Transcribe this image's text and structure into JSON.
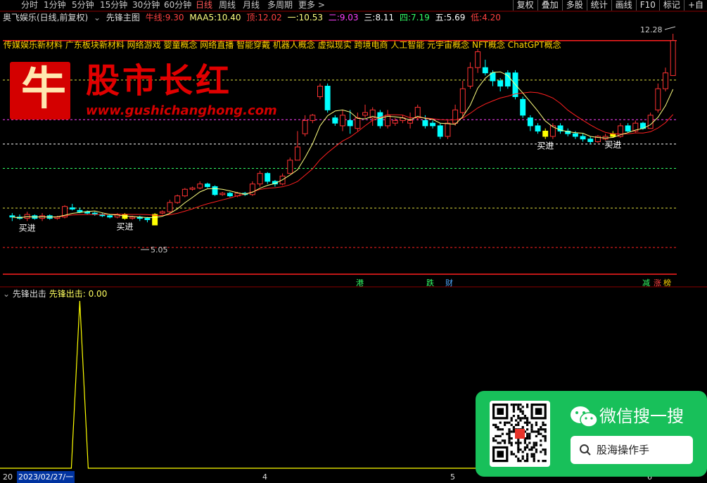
{
  "toolbar": {
    "timeframes": [
      "分时",
      "1分钟",
      "5分钟",
      "15分钟",
      "30分钟",
      "60分钟",
      "日线",
      "周线",
      "月线",
      "多周期",
      "更多 >"
    ],
    "active_timeframe": "日线",
    "right_buttons": [
      "复权",
      "叠加",
      "多股",
      "统计",
      "画线",
      "F10",
      "标记",
      "+自"
    ]
  },
  "info": {
    "stock": "奥飞娱乐(日线,前复权)",
    "indicator": "先锋主图",
    "niu_label": "牛线:",
    "niu": "9.30",
    "maa5_label": "MAA5:",
    "maa5": "10.40",
    "ding_label": "顶:",
    "ding": "12.02",
    "yi_label": "一:",
    "yi": "10.53",
    "er_label": "二:",
    "er": "9.03",
    "san_label": "三:",
    "san": "8.11",
    "si_label": "四:",
    "si": "7.19",
    "wu_label": "五:",
    "wu": "5.69",
    "di_label": "低:",
    "di": "4.20"
  },
  "concepts": "传媒娱乐新材料 广东板块新材料 网络游戏 婴童概念 网络直播 智能穿戴 机器人概念 虚拟现实 跨境电商 人工智能 元宇宙概念 NFT概念 ChatGPT概念",
  "logo": {
    "char": "牛",
    "title": "股市长红",
    "url": "www.gushichanghong.com"
  },
  "chart_annotations": {
    "high": "12.28",
    "low": "5.05",
    "buy": "买进"
  },
  "event_tags": [
    {
      "text": "港",
      "color": "#33ff66"
    },
    {
      "text": "跌",
      "color": "#33ff66"
    },
    {
      "text": "财",
      "color": "#4fa8ff"
    },
    {
      "text": "减",
      "color": "#33ff66"
    },
    {
      "text": "涨",
      "color": "#ff4040"
    },
    {
      "text": "榜",
      "color": "#ffd400"
    }
  ],
  "sub_indicator": {
    "name": "先锋出击",
    "label": "先锋出击:",
    "value": "0.00"
  },
  "date_axis": {
    "start": "20",
    "current": "2023/02/27/一",
    "m4": "4",
    "m5": "5",
    "m6": "6"
  },
  "wechat": {
    "title": "微信搜一搜",
    "search": "股海操作手"
  },
  "colors": {
    "up": "#ff3232",
    "down": "#00ffff",
    "ma_fast": "#ffff80",
    "ma_slow": "#ff2020",
    "signal": "#ffff00"
  },
  "chart_data": {
    "type": "candlestick",
    "price_range": [
      4.2,
      12.28
    ],
    "reference_levels": [
      12.02,
      10.53,
      9.03,
      8.11,
      7.19,
      5.69,
      4.2
    ],
    "candles": [
      [
        5.4,
        5.35,
        5.5,
        5.2
      ],
      [
        5.35,
        5.3,
        5.45,
        5.25
      ],
      [
        5.3,
        5.45,
        5.55,
        5.2
      ],
      [
        5.4,
        5.3,
        5.45,
        5.25
      ],
      [
        5.3,
        5.4,
        5.5,
        5.2
      ],
      [
        5.4,
        5.3,
        5.45,
        5.25
      ],
      [
        5.3,
        5.35,
        5.4,
        5.25
      ],
      [
        5.35,
        5.75,
        5.8,
        5.3
      ],
      [
        5.7,
        5.65,
        5.85,
        5.6
      ],
      [
        5.6,
        5.55,
        5.7,
        5.5
      ],
      [
        5.55,
        5.5,
        5.6,
        5.45
      ],
      [
        5.5,
        5.45,
        5.55,
        5.4
      ],
      [
        5.45,
        5.4,
        5.5,
        5.35
      ],
      [
        5.4,
        5.35,
        5.45,
        5.3
      ],
      [
        5.35,
        5.45,
        5.5,
        5.3
      ],
      [
        5.45,
        5.3,
        5.5,
        5.25
      ],
      [
        5.3,
        5.35,
        5.4,
        5.25
      ],
      [
        5.35,
        5.3,
        5.4,
        5.2
      ],
      [
        5.3,
        5.25,
        5.35,
        5.15
      ],
      [
        5.05,
        5.45,
        5.5,
        5.05
      ],
      [
        5.5,
        5.55,
        5.6,
        5.45
      ],
      [
        5.55,
        5.9,
        6.0,
        5.5
      ],
      [
        5.9,
        6.15,
        6.2,
        5.85
      ],
      [
        6.15,
        6.4,
        6.45,
        6.1
      ],
      [
        6.4,
        6.45,
        6.5,
        6.35
      ],
      [
        6.45,
        6.6,
        6.7,
        6.4
      ],
      [
        6.6,
        6.5,
        6.65,
        6.45
      ],
      [
        6.5,
        6.2,
        6.55,
        6.15
      ],
      [
        6.2,
        6.25,
        6.3,
        6.15
      ],
      [
        6.25,
        6.15,
        6.3,
        6.1
      ],
      [
        6.15,
        6.25,
        6.3,
        6.1
      ],
      [
        6.25,
        6.2,
        6.3,
        6.15
      ],
      [
        6.2,
        6.6,
        6.7,
        6.15
      ],
      [
        6.6,
        7.0,
        7.1,
        6.5
      ],
      [
        7.0,
        6.7,
        7.05,
        6.6
      ],
      [
        6.7,
        6.6,
        6.75,
        6.5
      ],
      [
        6.6,
        6.9,
        7.0,
        6.55
      ],
      [
        7.0,
        7.5,
        7.6,
        7.0
      ],
      [
        7.5,
        8.0,
        8.6,
        7.5
      ],
      [
        8.5,
        9.0,
        9.2,
        8.4
      ],
      [
        9.0,
        9.2,
        9.25,
        8.9
      ],
      [
        9.9,
        10.3,
        10.4,
        9.8
      ],
      [
        10.3,
        9.4,
        10.4,
        9.3
      ],
      [
        9.1,
        8.9,
        9.2,
        8.8
      ],
      [
        8.8,
        9.2,
        9.4,
        8.6
      ],
      [
        9.0,
        8.8,
        9.4,
        8.5
      ],
      [
        8.7,
        9.1,
        9.3,
        8.6
      ],
      [
        9.2,
        9.3,
        9.6,
        9.1
      ],
      [
        9.1,
        9.4,
        9.5,
        8.8
      ],
      [
        9.3,
        8.8,
        9.4,
        8.7
      ],
      [
        8.8,
        9.2,
        9.4,
        8.7
      ],
      [
        8.9,
        9.0,
        9.1,
        8.8
      ],
      [
        9.0,
        9.1,
        9.2,
        8.9
      ],
      [
        8.9,
        9.0,
        9.3,
        8.7
      ],
      [
        9.1,
        9.5,
        9.6,
        9.0
      ],
      [
        9.0,
        8.8,
        9.2,
        8.7
      ],
      [
        8.9,
        8.8,
        9.0,
        8.7
      ],
      [
        8.8,
        8.4,
        8.9,
        8.3
      ],
      [
        8.4,
        8.9,
        9.0,
        8.3
      ],
      [
        8.9,
        9.4,
        9.6,
        8.8
      ],
      [
        9.3,
        10.2,
        10.5,
        9.1
      ],
      [
        10.3,
        11.0,
        11.2,
        10.2
      ],
      [
        11.0,
        11.6,
        11.7,
        10.8
      ],
      [
        11.0,
        10.8,
        11.3,
        10.7
      ],
      [
        10.8,
        10.5,
        10.9,
        10.3
      ],
      [
        10.5,
        10.3,
        10.6,
        10.1
      ],
      [
        10.8,
        10.3,
        10.9,
        10.2
      ],
      [
        10.8,
        9.9,
        10.9,
        9.8
      ],
      [
        9.8,
        9.2,
        9.9,
        9.1
      ],
      [
        9.1,
        8.8,
        9.2,
        8.6
      ],
      [
        8.8,
        8.6,
        8.9,
        8.5
      ],
      [
        8.6,
        8.4,
        8.7,
        8.3
      ],
      [
        8.4,
        8.8,
        8.9,
        8.3
      ],
      [
        8.8,
        8.6,
        8.9,
        8.5
      ],
      [
        8.6,
        8.5,
        8.7,
        8.4
      ],
      [
        8.5,
        8.4,
        8.6,
        8.3
      ],
      [
        8.4,
        8.3,
        8.5,
        8.2
      ],
      [
        8.3,
        8.2,
        8.4,
        8.1
      ],
      [
        8.2,
        8.4,
        8.45,
        8.15
      ],
      [
        8.3,
        8.4,
        8.5,
        8.25
      ],
      [
        8.4,
        8.5,
        8.6,
        8.35
      ],
      [
        8.4,
        8.8,
        8.9,
        8.35
      ],
      [
        8.8,
        8.6,
        8.9,
        8.55
      ],
      [
        8.6,
        8.9,
        9.0,
        8.55
      ],
      [
        8.9,
        8.7,
        8.95,
        8.65
      ],
      [
        8.7,
        9.2,
        9.3,
        8.7
      ],
      [
        9.4,
        10.2,
        10.4,
        9.3
      ],
      [
        10.2,
        10.8,
        11.0,
        10.1
      ],
      [
        10.7,
        12.02,
        12.28,
        10.7
      ]
    ],
    "buy_signals": [
      2,
      15,
      71,
      80
    ],
    "yellow_candles": [
      15,
      19,
      71,
      80
    ],
    "signal_series_peak_index": 9,
    "signal_range": [
      0,
      1
    ]
  }
}
